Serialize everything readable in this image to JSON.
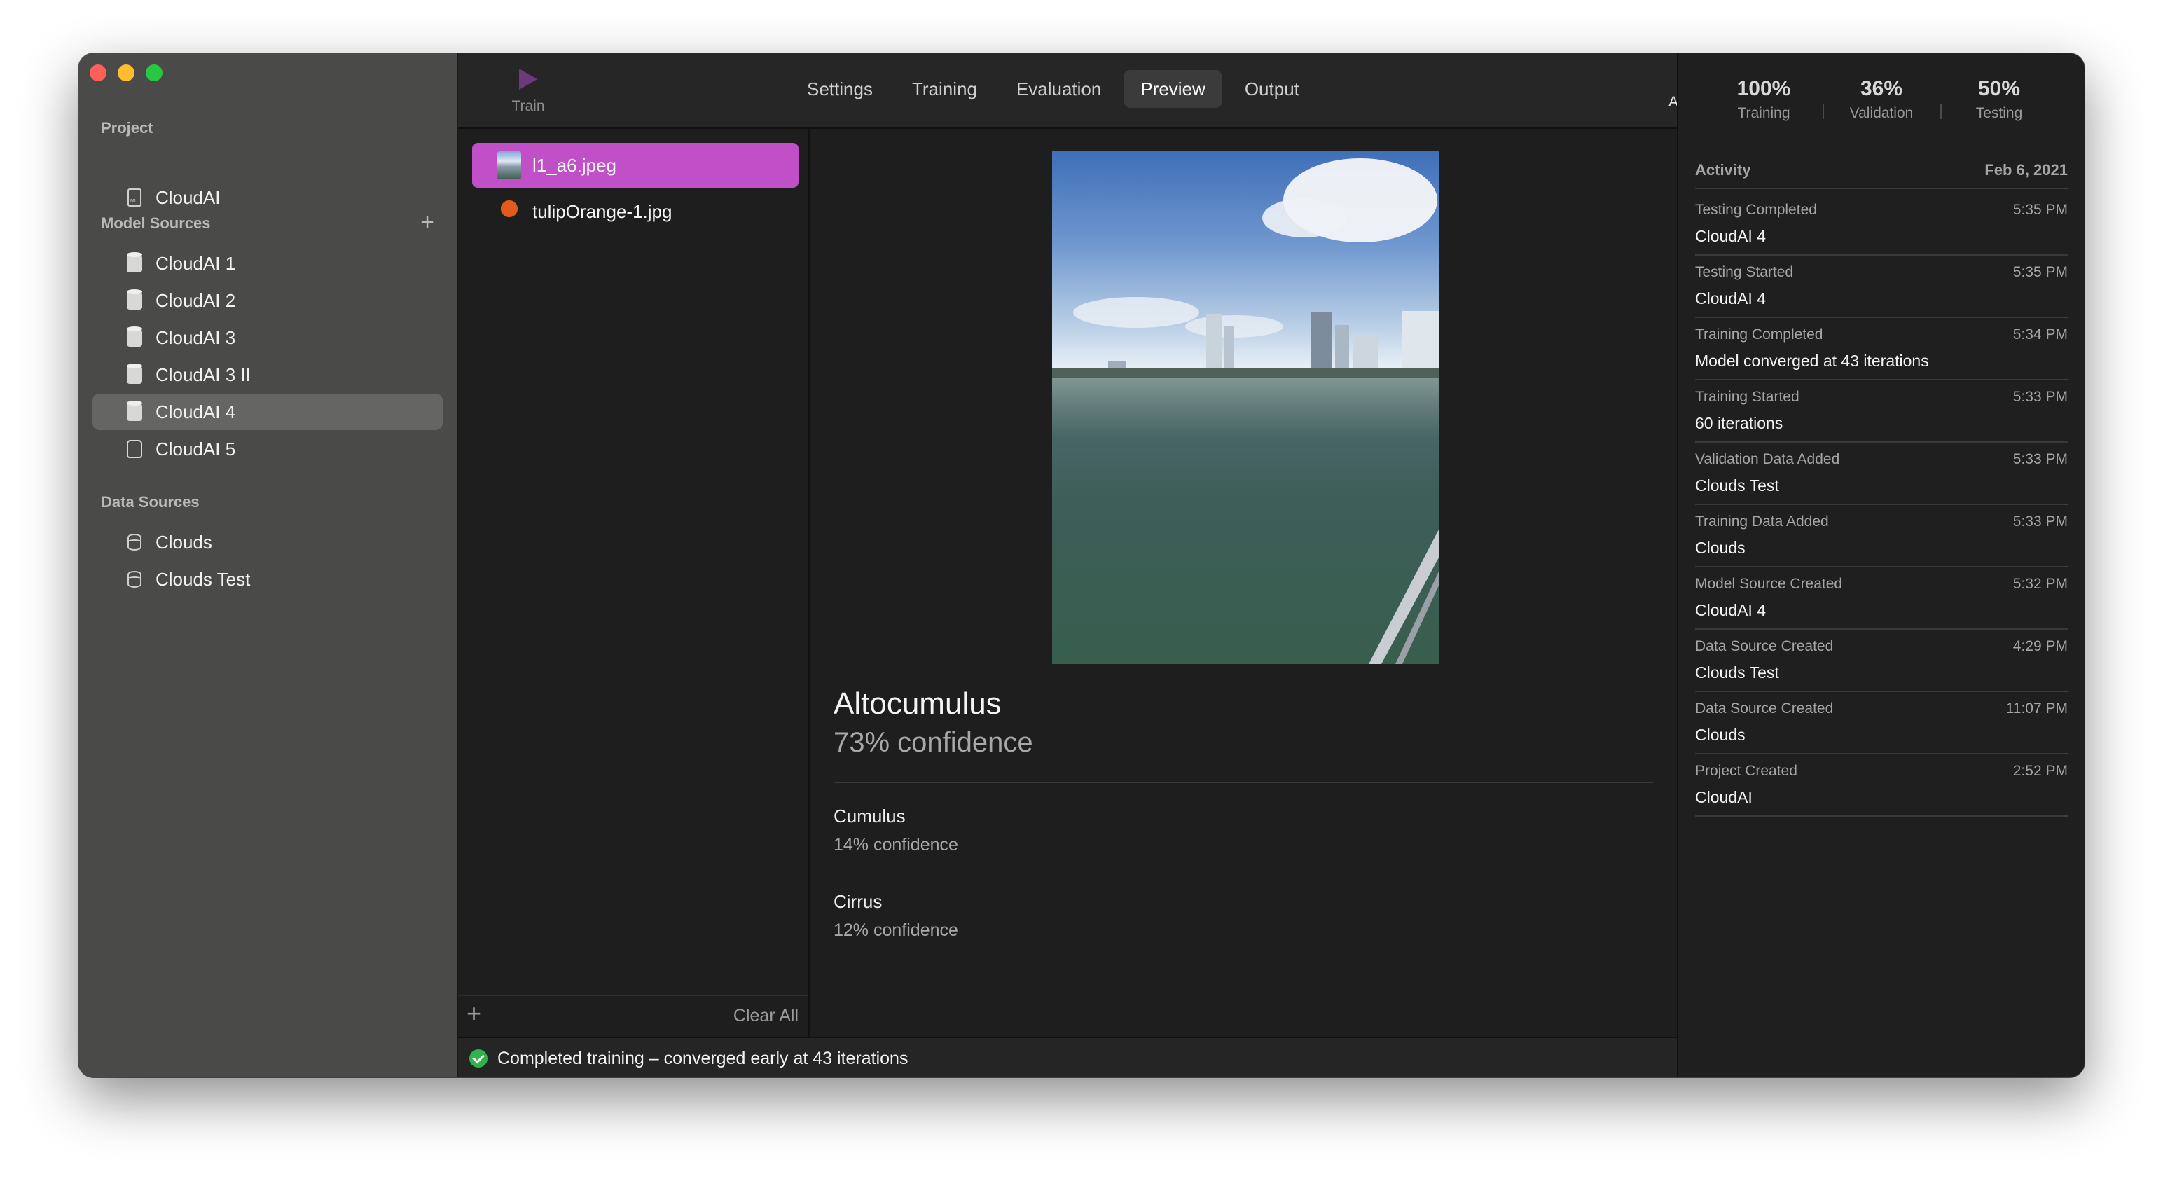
{
  "sidebar": {
    "project_header": "Project",
    "project_name": "CloudAI",
    "model_sources_header": "Model Sources",
    "models": [
      "CloudAI 1",
      "CloudAI 2",
      "CloudAI 3",
      "CloudAI 3 II",
      "CloudAI 4",
      "CloudAI 5"
    ],
    "selected_model": "CloudAI 4",
    "data_sources_header": "Data Sources",
    "data_sources": [
      "Clouds",
      "Clouds Test"
    ]
  },
  "toolbar": {
    "train_label": "Train",
    "tabs": [
      "Settings",
      "Training",
      "Evaluation",
      "Preview",
      "Output"
    ],
    "active_tab": "Preview",
    "activity_label": "Activity"
  },
  "stats": [
    {
      "value": "100%",
      "label": "Training"
    },
    {
      "value": "36%",
      "label": "Validation"
    },
    {
      "value": "50%",
      "label": "Testing"
    }
  ],
  "activity": {
    "header": "Activity",
    "date": "Feb 6, 2021",
    "items": [
      {
        "title": "Testing Completed",
        "time": "5:35 PM",
        "detail": "CloudAI 4"
      },
      {
        "title": "Testing Started",
        "time": "5:35 PM",
        "detail": "CloudAI 4"
      },
      {
        "title": "Training Completed",
        "time": "5:34 PM",
        "detail": "Model converged at 43 iterations"
      },
      {
        "title": "Training Started",
        "time": "5:33 PM",
        "detail": "60 iterations"
      },
      {
        "title": "Validation Data Added",
        "time": "5:33 PM",
        "detail": "Clouds Test"
      },
      {
        "title": "Training Data Added",
        "time": "5:33 PM",
        "detail": "Clouds"
      },
      {
        "title": "Model Source Created",
        "time": "5:32 PM",
        "detail": "CloudAI 4"
      },
      {
        "title": "Data Source Created",
        "time": "4:29 PM",
        "detail": "Clouds Test"
      },
      {
        "title": "Data Source Created",
        "time": "11:07 PM",
        "detail": "Clouds"
      },
      {
        "title": "Project Created",
        "time": "2:52 PM",
        "detail": "CloudAI"
      }
    ]
  },
  "files": {
    "items": [
      {
        "name": "l1_a6.jpeg",
        "thumb": "city-thumbnail"
      },
      {
        "name": "tulipOrange-1.jpg",
        "thumb": "tulip-thumbnail"
      }
    ],
    "selected": "l1_a6.jpeg",
    "clear_all": "Clear All"
  },
  "prediction": {
    "top_label": "Altocumulus",
    "top_confidence": "73% confidence",
    "others": [
      {
        "label": "Cumulus",
        "confidence": "14% confidence"
      },
      {
        "label": "Cirrus",
        "confidence": "12% confidence"
      }
    ]
  },
  "status": {
    "text": "Completed training – converged early at 43 iterations",
    "icon": "checkmark-circle-icon"
  },
  "colors": {
    "accent": "#c14fc8",
    "success": "#2fb34a",
    "sidebar_bg": "#4a4a48",
    "window_bg": "#1e1e1e"
  }
}
